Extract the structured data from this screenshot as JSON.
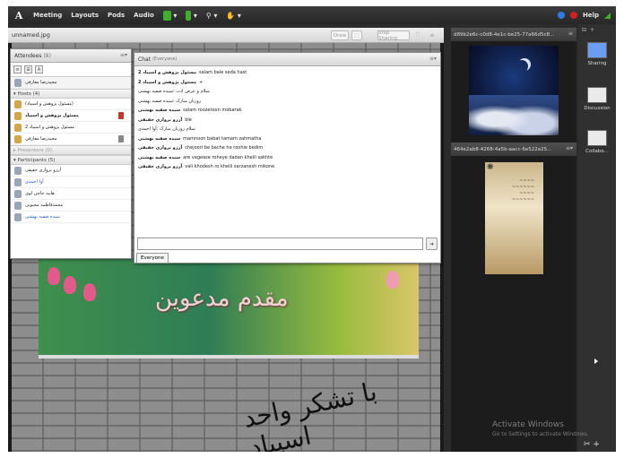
{
  "menubar": {
    "items": [
      "Meeting",
      "Layouts",
      "Pods",
      "Audio"
    ],
    "help": "Help"
  },
  "share_pod": {
    "title": "unnamed.jpg",
    "buttons": {
      "draw": "Draw",
      "stop_sharing": "Stop Sharing"
    },
    "banner_text": "مقدم مدعوین",
    "calligraphy": "با تشکر واحد اسپیاد"
  },
  "attendees": {
    "title": "Attendees",
    "count": "(8)",
    "self_name": "مجیدرضا معارفی",
    "hosts_header": "Hosts (4)",
    "hosts": [
      {
        "name": "(مسئول پژوهش و اسپیاد)",
        "blue": false
      },
      {
        "name": "مسئول پژوهش و اسپیاد",
        "blue": false
      },
      {
        "name": "مسئول پژوهش و اسپیاد 2",
        "blue": false
      },
      {
        "name": "مجیدرضا معارفی",
        "blue": false
      }
    ],
    "presenters_header": "Presenters (0)",
    "participants_header": "Participants (5)",
    "participants": [
      {
        "name": "آرزو بروازی حقیقی",
        "blue": false
      },
      {
        "name": "آوا احمدی",
        "blue": true
      },
      {
        "name": "هانیه حاجی لوی",
        "blue": false
      },
      {
        "name": "محمدفاطمه محبوبی",
        "blue": false
      },
      {
        "name": "سیده صفیه بهشتی",
        "blue": true
      }
    ]
  },
  "chat": {
    "title": "Chat",
    "scope": "(Everyone)",
    "messages": [
      {
        "from": "مسئول پژوهش و اسپیاد 2",
        "text": "salam bale seda hast"
      },
      {
        "from": "مسئول پژوهش و اسپیاد 2",
        "text": "+"
      },
      {
        "from": "",
        "text": "سلام و عرض ادب :سیده صفیه بهشتی"
      },
      {
        "from": "",
        "text": "روزتان مبارک :سیده صفیه بهشتی"
      },
      {
        "from": "سیده صفیه بهشتی",
        "text": "salam roozetoon mobarak"
      },
      {
        "from": "آرزو بروازی حقیقی",
        "text": "ble"
      },
      {
        "from": "",
        "text": "سلام روزتان مبارک :آوا احمدی"
      },
      {
        "from": "سیده صفیه بهشتی",
        "text": "mamnoon babat tamam zahmatha"
      },
      {
        "from": "آرزو بروازی حقیقی",
        "text": "chejoori be bache ha roohie bedim"
      },
      {
        "from": "سیده صفیه بهشتی",
        "text": "are vagease roheye dadan kheili sakhte"
      },
      {
        "from": "آرزو بروازی حقیقی",
        "text": "vali khodesh ro kheili sarzanesh mikone"
      }
    ],
    "tab_label": "Everyone"
  },
  "video_pods": [
    {
      "title": "d89b2e6c-c0d8-4e1c-be25-77a66d5c8..."
    },
    {
      "title": "464e2ab8-4268-4a5b-aacc-6e522a25..."
    }
  ],
  "sidebar": {
    "items": [
      "Sharing",
      "Discussion",
      "Collabo..."
    ]
  },
  "watermark": {
    "title": "Activate Windows",
    "subtitle": "Go to Settings to activate Windows."
  },
  "colors": {
    "accent": "#2a5bd7",
    "record": "#d22020",
    "mic": "#3fae2a"
  }
}
